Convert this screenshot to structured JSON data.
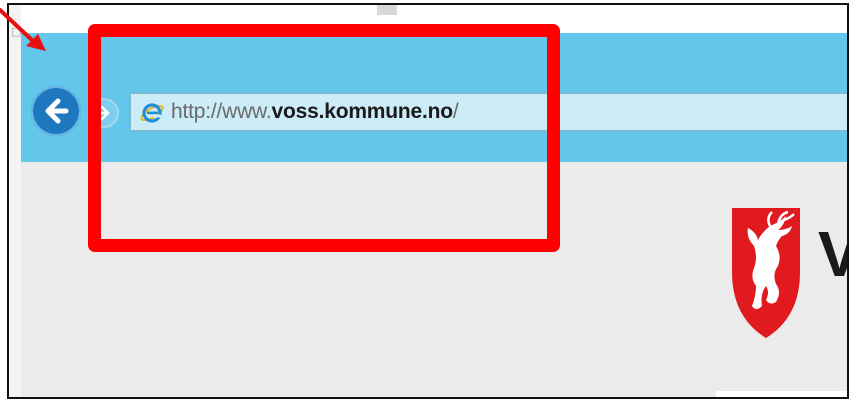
{
  "browser": {
    "address_bar": {
      "url_prefix": "http://www.",
      "url_domain": "voss.kommune.no",
      "url_suffix": "/"
    },
    "back_button_icon": "arrow-left-icon",
    "forward_button_icon": "arrow-right-icon",
    "page_icon": "internet-explorer-icon",
    "titlebar_color": "#62c7ea"
  },
  "page": {
    "logo_icon": "voss-coat-of-arms-icon",
    "logo_letter": "V"
  },
  "annotations": {
    "highlight_color": "#ff0000",
    "arrow_color": "#e81010",
    "left_strip_glyph": "□"
  }
}
